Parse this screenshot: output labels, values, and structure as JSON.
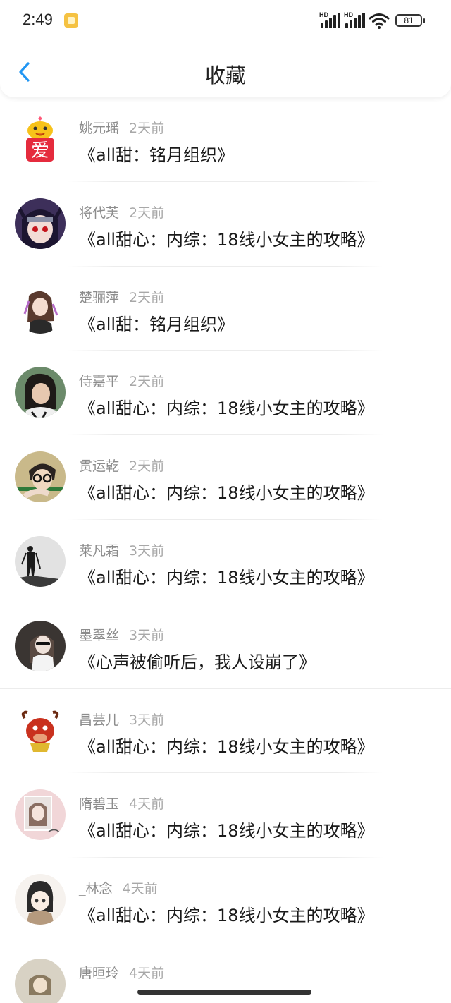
{
  "status_bar": {
    "time": "2:49",
    "signal_1_label": "HD",
    "signal_2_label": "HD",
    "battery": "81",
    "icons": [
      "notification-icon",
      "signal-icon",
      "signal-icon",
      "wifi-icon",
      "battery-icon"
    ]
  },
  "header": {
    "title": "收藏",
    "back_icon": "chevron-left-icon",
    "accent_color": "#2196f3"
  },
  "items": [
    {
      "user": "姚元瑶",
      "time": "2天前",
      "title": "《all甜：铭月组织》",
      "avatar": "yellow-bird-love-avatar"
    },
    {
      "user": "将代芙",
      "time": "2天前",
      "title": "《all甜心：内综：18线小女主的攻略》",
      "avatar": "anime-character-avatar"
    },
    {
      "user": "楚骊萍",
      "time": "2天前",
      "title": "《all甜：铭月组织》",
      "avatar": "girl-illustration-avatar"
    },
    {
      "user": "侍嘉平",
      "time": "2天前",
      "title": "《all甜心：内综：18线小女主的攻略》",
      "avatar": "girl-photo-avatar"
    },
    {
      "user": "贯运乾",
      "time": "2天前",
      "title": "《all甜心：内综：18线小女主的攻略》",
      "avatar": "glasses-photo-avatar"
    },
    {
      "user": "莱凡霜",
      "time": "3天前",
      "title": "《all甜心：内综：18线小女主的攻略》",
      "avatar": "hiker-silhouette-avatar"
    },
    {
      "user": "墨翠丝",
      "time": "3天前",
      "title": "《心声被偷听后，我人设崩了》",
      "avatar": "girl-sunglasses-avatar"
    },
    {
      "user": "昌芸儿",
      "time": "3天前",
      "title": "《all甜心：内综：18线小女主的攻略》",
      "avatar": "red-bull-avatar"
    },
    {
      "user": "隋碧玉",
      "time": "4天前",
      "title": "《all甜心：内综：18线小女主的攻略》",
      "avatar": "pink-photo-avatar"
    },
    {
      "user": "_林念",
      "time": "4天前",
      "title": "《all甜心：内综：18线小女主的攻略》",
      "avatar": "anime-girl-avatar"
    },
    {
      "user": "唐晅玲",
      "time": "4天前",
      "title": "",
      "avatar": "partial-photo-avatar"
    }
  ]
}
